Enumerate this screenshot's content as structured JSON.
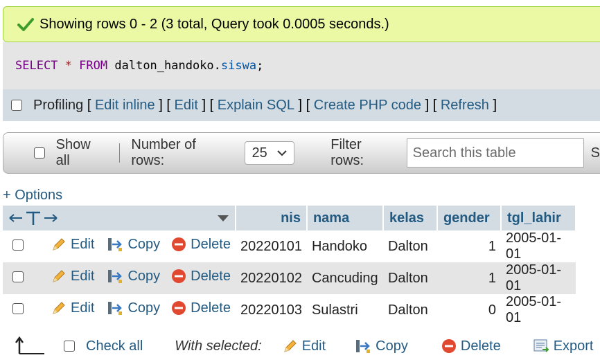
{
  "status": {
    "message": "Showing rows 0 - 2 (3 total, Query took 0.0005 seconds.)"
  },
  "sql": {
    "kw_select": "SELECT",
    "star": "*",
    "kw_from": "FROM",
    "table": "dalton_handoko",
    "dot": ".",
    "field": "siswa",
    "semi": ";"
  },
  "profiling": {
    "label": "Profiling",
    "links": [
      "Edit inline",
      "Edit",
      "Explain SQL",
      "Create PHP code",
      "Refresh"
    ]
  },
  "nav": {
    "show_all": "Show all",
    "rows_label": "Number of rows:",
    "rows_value": "25",
    "filter_label": "Filter rows:",
    "search_placeholder": "Search this table",
    "tail": "S"
  },
  "options": "+ Options",
  "table": {
    "columns": [
      "nis",
      "nama",
      "kelas",
      "gender",
      "tgl_lahir"
    ],
    "row_actions": {
      "edit": "Edit",
      "copy": "Copy",
      "delete": "Delete"
    },
    "rows": [
      {
        "nis": "20220101",
        "nama": "Handoko",
        "kelas": "Dalton",
        "gender": "1",
        "tgl_lahir": "2005-01-01"
      },
      {
        "nis": "20220102",
        "nama": "Cancuding",
        "kelas": "Dalton",
        "gender": "1",
        "tgl_lahir": "2005-01-01"
      },
      {
        "nis": "20220103",
        "nama": "Sulastri",
        "kelas": "Dalton",
        "gender": "0",
        "tgl_lahir": "2005-01-01"
      }
    ]
  },
  "bottom": {
    "check_all": "Check all",
    "with_selected": "With selected:",
    "edit": "Edit",
    "copy": "Copy",
    "delete": "Delete",
    "export": "Export"
  },
  "colors": {
    "link": "#235a81",
    "success_bg": "#ebf8a4",
    "header_bg": "#d3dce3"
  }
}
